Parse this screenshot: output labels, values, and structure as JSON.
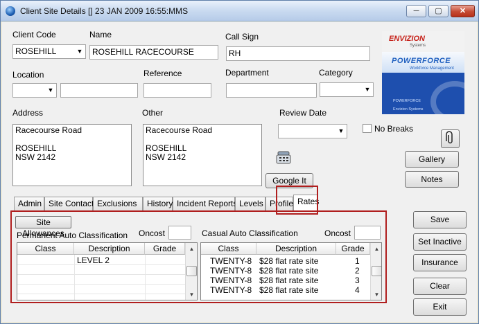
{
  "window": {
    "title": "Client Site Details [] 23 JAN 2009 16:55:MMS",
    "minimize_glyph": "─",
    "maximize_glyph": "▢",
    "close_glyph": "✕"
  },
  "form": {
    "client_code": {
      "label": "Client Code",
      "value": "ROSEHILL"
    },
    "name": {
      "label": "Name",
      "value": "ROSEHILL RACECOURSE"
    },
    "call_sign": {
      "label": "Call Sign",
      "value": "RH"
    },
    "location": {
      "label": "Location",
      "value": "",
      "text_value": ""
    },
    "reference": {
      "label": "Reference",
      "value": ""
    },
    "department": {
      "label": "Department",
      "value": ""
    },
    "category": {
      "label": "Category",
      "value": ""
    },
    "address": {
      "label": "Address",
      "value": "Racecourse Road\n\nROSEHILL\nNSW 2142"
    },
    "other": {
      "label": "Other",
      "value": "Racecourse Road\n\nROSEHILL\nNSW 2142"
    },
    "review_date": {
      "label": "Review Date",
      "value": ""
    },
    "no_breaks": {
      "label": "No Breaks",
      "checked": false
    }
  },
  "logo": {
    "brand_top": "ENVIZION",
    "brand_top_sub": "Systems",
    "brand_main": "POWERFORCE",
    "brand_main_sub": "Workforce Management",
    "lines": [
      "POWERFORCE",
      "Envizion Systems"
    ]
  },
  "side_buttons": {
    "google_it": "Google It",
    "gallery": "Gallery",
    "notes": "Notes",
    "save": "Save",
    "set_inactive": "Set Inactive",
    "insurance": "Insurance",
    "clear": "Clear",
    "exit": "Exit"
  },
  "tabs": [
    {
      "label": "Admin"
    },
    {
      "label": "Site Contact"
    },
    {
      "label": "Exclusions"
    },
    {
      "label": "History"
    },
    {
      "label": "Incident Reports"
    },
    {
      "label": "Levels"
    },
    {
      "label": "Profile"
    },
    {
      "label": "Rates",
      "active": true
    }
  ],
  "rates": {
    "site_allowances_button": "Site Allowances",
    "permanent_label": "Permanent Auto Classification",
    "permanent_oncost_label": "Oncost",
    "permanent_oncost_value": "",
    "casual_label": "Casual Auto Classification",
    "casual_oncost_label": "Oncost",
    "casual_oncost_value": "",
    "permanent_columns": [
      "Class",
      "Description",
      "Grade"
    ],
    "permanent_rows": [
      {
        "class": "",
        "description": "LEVEL 2",
        "grade": ""
      }
    ],
    "casual_columns": [
      "Class",
      "Description",
      "Grade"
    ],
    "casual_rows": [
      {
        "class": "TWENTY-8",
        "description": "$28 flat rate site",
        "grade": "1"
      },
      {
        "class": "TWENTY-8",
        "description": "$28 flat rate site",
        "grade": "2"
      },
      {
        "class": "TWENTY-8",
        "description": "$28 flat rate site",
        "grade": "3"
      },
      {
        "class": "TWENTY-8",
        "description": "$28 flat rate site",
        "grade": "4"
      }
    ]
  },
  "colors": {
    "highlight_box": "#b01e1e",
    "title_bar": "#c9daf0",
    "close_button": "#c44a33"
  }
}
